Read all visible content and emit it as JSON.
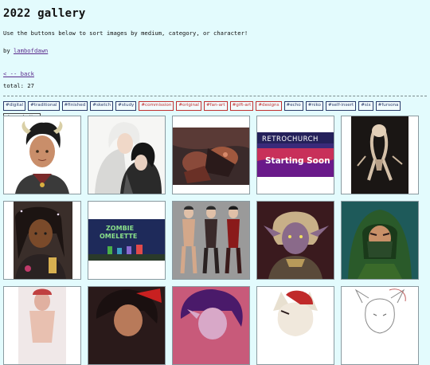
{
  "page": {
    "title": "2022 gallery",
    "intro": "Use the buttons below to sort images by medium, category, or character!",
    "by_prefix": "by ",
    "author": "lambofdawn",
    "back_link": "< -- back",
    "total": "total: 27"
  },
  "filters": [
    {
      "label": "#digital",
      "style": "dark"
    },
    {
      "label": "#traditional",
      "style": "dark"
    },
    {
      "label": "#finished",
      "style": "dark"
    },
    {
      "label": "#sketch",
      "style": "dark"
    },
    {
      "label": "#study",
      "style": "dark"
    },
    {
      "label": "#commission",
      "style": "red"
    },
    {
      "label": "#original",
      "style": "red"
    },
    {
      "label": "#fan-art",
      "style": "red"
    },
    {
      "label": "#gift-art",
      "style": "red"
    },
    {
      "label": "#designs",
      "style": "red"
    },
    {
      "label": "#echo",
      "style": "dark"
    },
    {
      "label": "#niko",
      "style": "dark"
    },
    {
      "label": "#self-insert",
      "style": "dark"
    },
    {
      "label": "#six",
      "style": "dark"
    },
    {
      "label": "#fursona",
      "style": "dark"
    },
    {
      "label": "clear selection",
      "style": "clear"
    }
  ],
  "thumbnails": {
    "retro_title": "RETROCHURCH",
    "retro_subtitle": "Starting Soon",
    "zombie_line1": "ZOMBIE",
    "zombie_line2": "OMELETTE"
  },
  "colors": {
    "background": "#e3fbfd",
    "link": "#5a2a8c",
    "filter_red": "#c03030"
  }
}
